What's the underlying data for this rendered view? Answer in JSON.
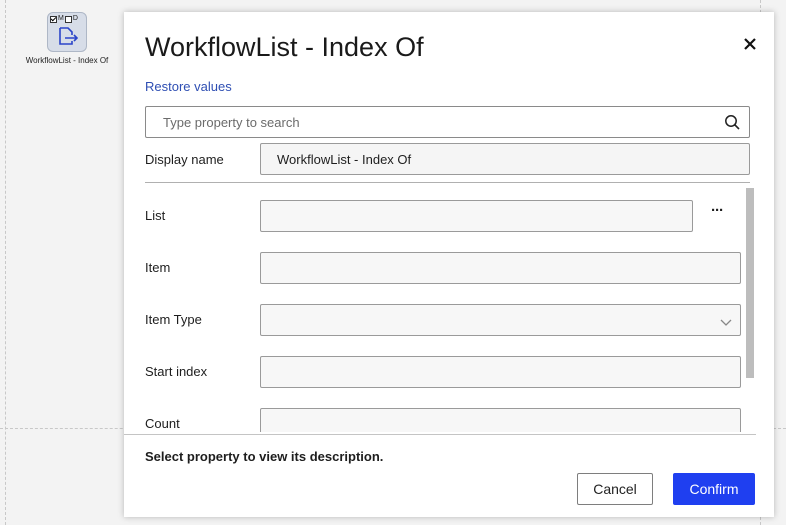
{
  "canvas": {
    "node": {
      "label": "WorkflowList - Index Of",
      "flag_m": "M",
      "flag_d": "D",
      "flag_m_checked": true,
      "flag_d_checked": false,
      "icon": "export-file-icon"
    }
  },
  "dialog": {
    "title": "WorkflowList - Index Of",
    "close_icon": "close-icon",
    "restore_label": "Restore values",
    "search": {
      "value": "",
      "placeholder": "Type property to search",
      "icon": "search-icon"
    },
    "display_name": {
      "label": "Display name",
      "value": "WorkflowList - Index Of"
    },
    "properties": [
      {
        "label": "List",
        "value": "",
        "has_more": true,
        "more_label": "···"
      },
      {
        "label": "Item",
        "value": ""
      },
      {
        "label": "Item Type",
        "value": "",
        "dropdown": true
      },
      {
        "label": "Start index",
        "value": ""
      },
      {
        "label": "Count",
        "value": ""
      }
    ],
    "description": "Select property to view its description.",
    "cancel_label": "Cancel",
    "confirm_label": "Confirm",
    "colors": {
      "accent": "#1f3ff0",
      "link": "#2f4fb3"
    }
  }
}
